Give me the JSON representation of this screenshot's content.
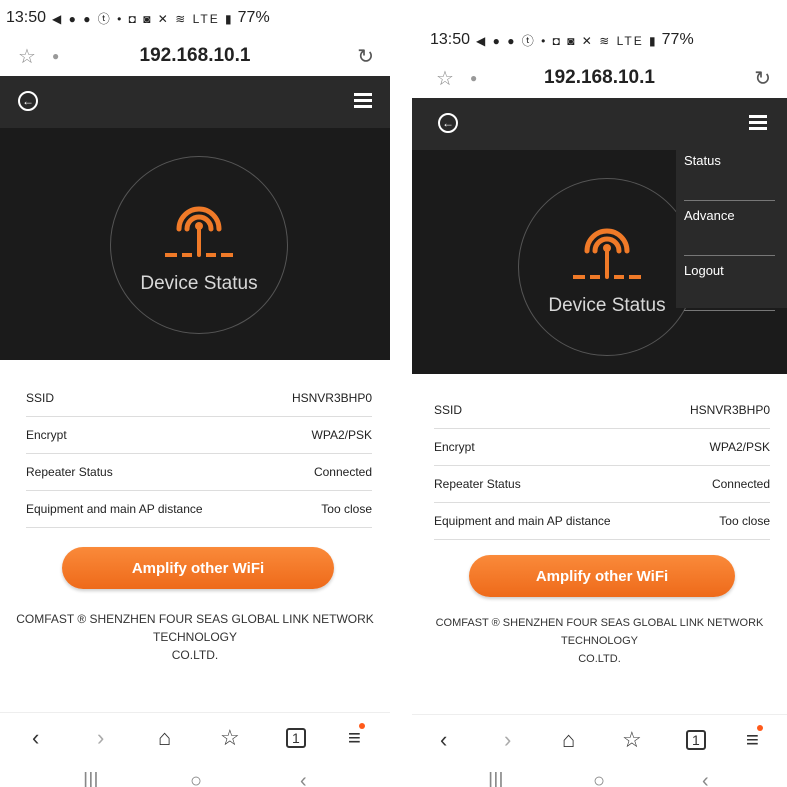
{
  "status_bar": {
    "time": "13:50",
    "indicators": "◀ ● ● ⓣ •   ◘ ◙ ✕ ≋ LTE ▮",
    "battery": "77%"
  },
  "address_bar": {
    "url": "192.168.10.1",
    "star_icon": "☆",
    "info_icon": "●",
    "reload_icon": "↻"
  },
  "app": {
    "back_icon": "←",
    "menu_icon": "hamburger"
  },
  "hero": {
    "label": "Device Status"
  },
  "menu": {
    "items": [
      "Status",
      "Advance",
      "Logout"
    ]
  },
  "info": [
    {
      "key": "SSID",
      "value": "HSNVR3BHP0"
    },
    {
      "key": "Encrypt",
      "value": "WPA2/PSK"
    },
    {
      "key": "Repeater Status",
      "value": "Connected"
    },
    {
      "key": "Equipment and main AP distance",
      "value": "Too close"
    }
  ],
  "action": {
    "amplify_label": "Amplify other WiFi"
  },
  "footer": {
    "line1": "COMFAST ® SHENZHEN FOUR SEAS GLOBAL LINK NETWORK TECHNOLOGY",
    "line2": "CO.LTD."
  },
  "browser_nav": {
    "back": "‹",
    "forward": "›",
    "home": "⌂",
    "bookmarks": "☆",
    "tabs": "1",
    "menu": "≡"
  },
  "system_nav": {
    "recents": "|||",
    "home": "○",
    "back": "‹"
  },
  "colors": {
    "accent": "#f07a28",
    "header": "#2a2a2a",
    "hero": "#1b1b1b"
  }
}
